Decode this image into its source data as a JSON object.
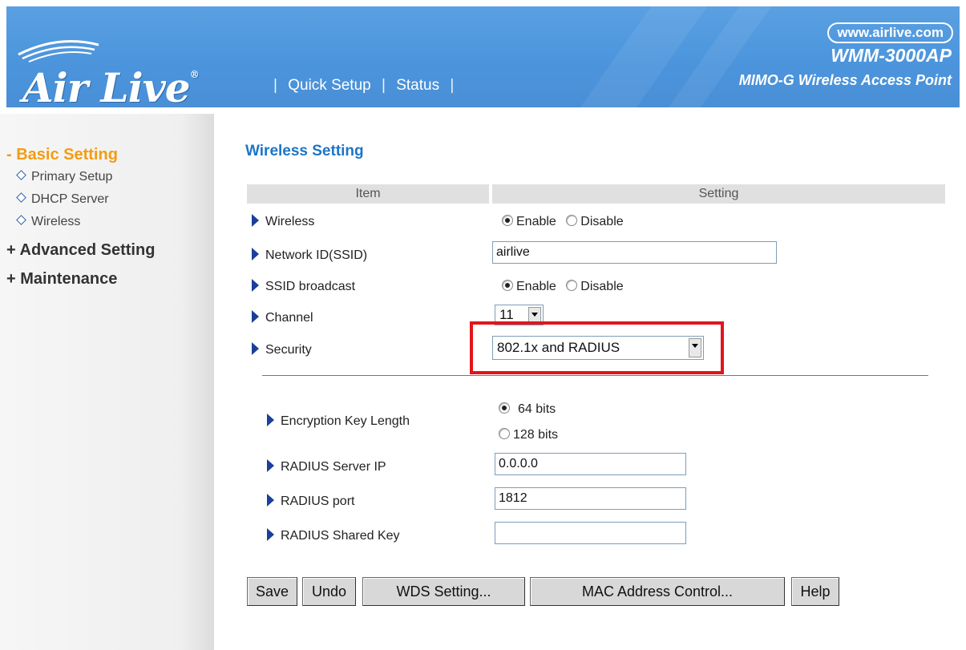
{
  "header": {
    "logo_text": "Air Live",
    "logo_mark": "®",
    "nav": [
      {
        "label": "Quick Setup"
      },
      {
        "label": "Status"
      }
    ],
    "url": "www.airlive.com",
    "model": "WMM-3000AP",
    "subtitle": "MIMO-G Wireless Access Point"
  },
  "sidebar": {
    "basic": "- Basic Setting",
    "items": [
      {
        "label": "Primary Setup"
      },
      {
        "label": "DHCP Server"
      },
      {
        "label": "Wireless"
      }
    ],
    "advanced": "+ Advanced Setting",
    "maintenance": "+ Maintenance"
  },
  "main": {
    "title": "Wireless Setting",
    "col_item": "Item",
    "col_setting": "Setting",
    "wireless": {
      "label": "Wireless",
      "enable": "Enable",
      "disable": "Disable",
      "selected": "Enable"
    },
    "ssid": {
      "label": "Network ID(SSID)",
      "value": "airlive"
    },
    "broadcast": {
      "label": "SSID broadcast",
      "enable": "Enable",
      "disable": "Disable",
      "selected": "Enable"
    },
    "channel": {
      "label": "Channel",
      "value": "11"
    },
    "security": {
      "label": "Security",
      "value": "802.1x and RADIUS"
    },
    "keylen": {
      "label": "Encryption Key Length",
      "opt64": "64 bits",
      "opt128": "128 bits",
      "selected": "64 bits"
    },
    "radius_ip": {
      "label": "RADIUS Server IP",
      "value": "0.0.0.0"
    },
    "radius_port": {
      "label": "RADIUS port",
      "value": "1812"
    },
    "radius_key": {
      "label": "RADIUS Shared Key",
      "value": ""
    },
    "buttons": {
      "save": "Save",
      "undo": "Undo",
      "wds": "WDS Setting...",
      "mac": "MAC Address Control...",
      "help": "Help"
    },
    "highlight_color": "#e3141b"
  }
}
